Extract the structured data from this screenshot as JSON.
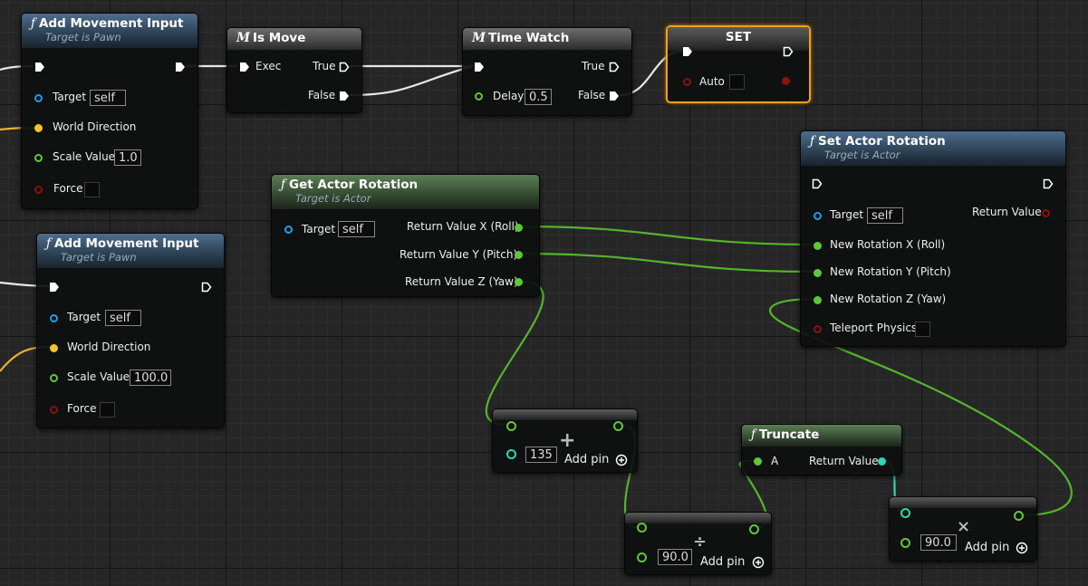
{
  "nodes": {
    "add_movement_1": {
      "title": "Add Movement Input",
      "subtitle": "Target is Pawn",
      "target_label": "Target",
      "target_value": "self",
      "direction_label": "World Direction",
      "scale_label": "Scale Value",
      "scale_value": "1.0",
      "force_label": "Force"
    },
    "add_movement_2": {
      "title": "Add Movement Input",
      "subtitle": "Target is Pawn",
      "target_label": "Target",
      "target_value": "self",
      "direction_label": "World Direction",
      "scale_label": "Scale Value",
      "scale_value": "100.0",
      "force_label": "Force"
    },
    "is_move": {
      "title": "Is Move",
      "exec_label": "Exec",
      "true_label": "True",
      "false_label": "False"
    },
    "time_watch": {
      "title": "Time Watch",
      "delay_label": "Delay",
      "delay_value": "0.5",
      "true_label": "True",
      "false_label": "False"
    },
    "set": {
      "title": "SET",
      "auto_label": "Auto"
    },
    "get_actor_rotation": {
      "title": "Get Actor Rotation",
      "subtitle": "Target is Actor",
      "target_label": "Target",
      "target_value": "self",
      "x_label": "Return Value X (Roll)",
      "y_label": "Return Value Y (Pitch)",
      "z_label": "Return Value Z (Yaw)"
    },
    "set_actor_rotation": {
      "title": "Set Actor Rotation",
      "subtitle": "Target is Actor",
      "target_label": "Target",
      "target_value": "self",
      "return_label": "Return Value",
      "x_label": "New Rotation X (Roll)",
      "y_label": "New Rotation Y (Pitch)",
      "z_label": "New Rotation Z (Yaw)",
      "teleport_label": "Teleport Physics"
    },
    "add": {
      "symbol": "+",
      "value": "135",
      "add_pin_label": "Add pin"
    },
    "divide": {
      "symbol": "÷",
      "value": "90.0",
      "add_pin_label": "Add pin"
    },
    "multiply": {
      "symbol": "×",
      "value": "90.0",
      "add_pin_label": "Add pin"
    },
    "truncate": {
      "title": "Truncate",
      "a_label": "A",
      "return_label": "Return Value"
    }
  },
  "icons": {
    "function": "function-f-icon",
    "macro": "macro-m-icon",
    "add_pin": "plus-circle-icon"
  },
  "colors": {
    "exec": "#ffffff",
    "object": "#1e9ce8",
    "vector": "#f4c32b",
    "float": "#5ec83a",
    "bool": "#8e1010",
    "int": "#2fe0b8",
    "selected": "#f0a020"
  }
}
